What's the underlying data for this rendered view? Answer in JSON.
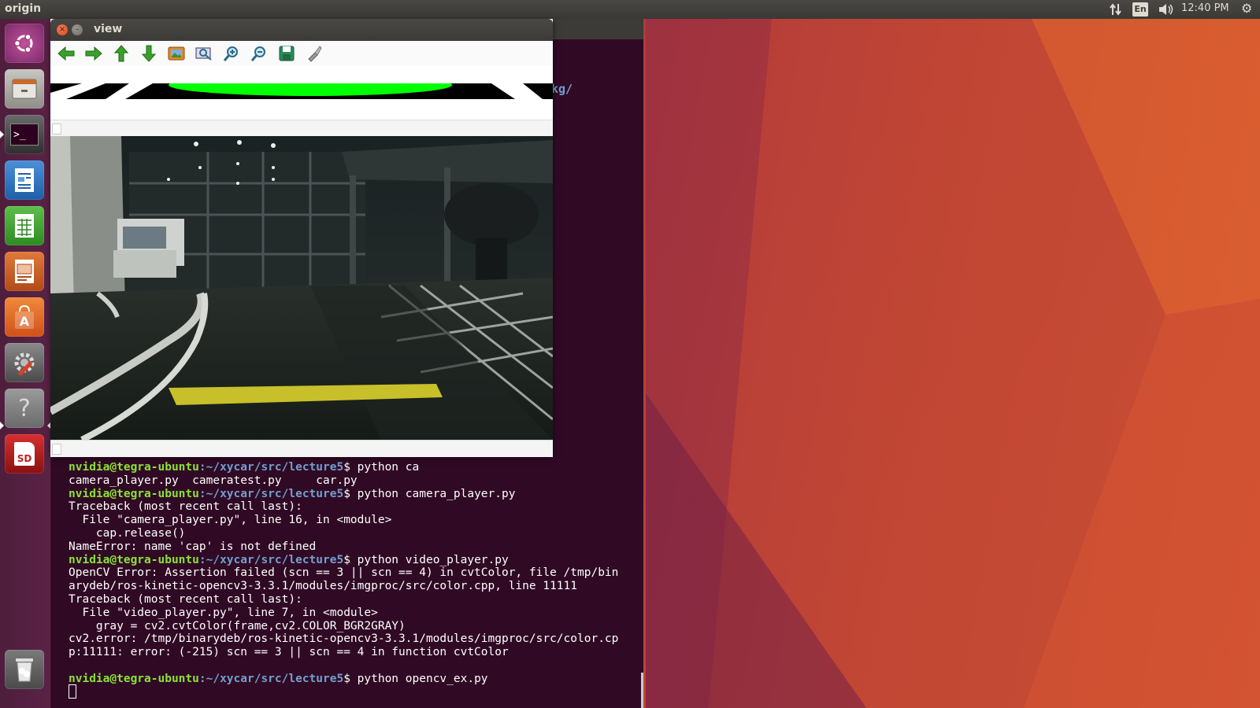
{
  "top_panel": {
    "title": "origin",
    "lang": "En",
    "clock": "12:40 PM"
  },
  "launcher": {
    "items": [
      {
        "name": "ubuntu-dash",
        "icon": "ubuntu-logo-icon"
      },
      {
        "name": "files",
        "icon": "file-cabinet-icon"
      },
      {
        "name": "terminal",
        "icon": "terminal-icon"
      },
      {
        "name": "writer",
        "icon": "document-icon"
      },
      {
        "name": "calc",
        "icon": "spreadsheet-icon"
      },
      {
        "name": "impress",
        "icon": "presentation-icon"
      },
      {
        "name": "software-center",
        "icon": "shopping-bag-icon"
      },
      {
        "name": "system-settings",
        "icon": "wrench-gear-icon"
      },
      {
        "name": "help",
        "icon": "help-icon"
      },
      {
        "name": "sd-card",
        "icon": "sd-card-icon"
      },
      {
        "name": "trash",
        "icon": "trash-icon"
      }
    ],
    "sd_label": "SD",
    "help_glyph": "?",
    "terminal_glyph": ">_"
  },
  "view_window": {
    "title": "view",
    "close_glyph": "×",
    "min_glyph": "–",
    "toolbar": [
      {
        "name": "back",
        "icon": "arrow-left-icon"
      },
      {
        "name": "forward",
        "icon": "arrow-right-icon"
      },
      {
        "name": "up",
        "icon": "arrow-up-icon"
      },
      {
        "name": "down",
        "icon": "arrow-down-icon"
      },
      {
        "name": "image",
        "icon": "image-icon"
      },
      {
        "name": "zoom-fit",
        "icon": "zoom-fit-icon"
      },
      {
        "name": "zoom-in",
        "icon": "zoom-in-icon"
      },
      {
        "name": "zoom-out",
        "icon": "zoom-out-icon"
      },
      {
        "name": "save",
        "icon": "save-icon"
      },
      {
        "name": "settings",
        "icon": "brush-icon"
      }
    ]
  },
  "terminal": {
    "fragment_top": "kg/",
    "lines": [
      {
        "user": "nvidia@tegra-ubuntu",
        "path": ":~/xycar/src/lecture5",
        "cmd": "$ python ca"
      },
      {
        "text": "camera_player.py  cameratest.py     car.py"
      },
      {
        "user": "nvidia@tegra-ubuntu",
        "path": ":~/xycar/src/lecture5",
        "cmd": "$ python camera_player.py"
      },
      {
        "text": "Traceback (most recent call last):"
      },
      {
        "text": "  File \"camera_player.py\", line 16, in <module>"
      },
      {
        "text": "    cap.release()"
      },
      {
        "text": "NameError: name 'cap' is not defined"
      },
      {
        "user": "nvidia@tegra-ubuntu",
        "path": ":~/xycar/src/lecture5",
        "cmd": "$ python video_player.py"
      },
      {
        "text": "OpenCV Error: Assertion failed (scn == 3 || scn == 4) in cvtColor, file /tmp/bin"
      },
      {
        "text": "arydeb/ros-kinetic-opencv3-3.3.1/modules/imgproc/src/color.cpp, line 11111"
      },
      {
        "text": "Traceback (most recent call last):"
      },
      {
        "text": "  File \"video_player.py\", line 7, in <module>"
      },
      {
        "text": "    gray = cv2.cvtColor(frame,cv2.COLOR_BGR2GRAY)"
      },
      {
        "text": "cv2.error: /tmp/binarydeb/ros-kinetic-opencv3-3.3.1/modules/imgproc/src/color.cp"
      },
      {
        "text": "p:11111: error: (-215) scn == 3 || scn == 4 in function cvtColor"
      },
      {
        "text": ""
      },
      {
        "user": "nvidia@tegra-ubuntu",
        "path": ":~/xycar/src/lecture5",
        "cmd": "$ python opencv_ex.py"
      }
    ]
  }
}
